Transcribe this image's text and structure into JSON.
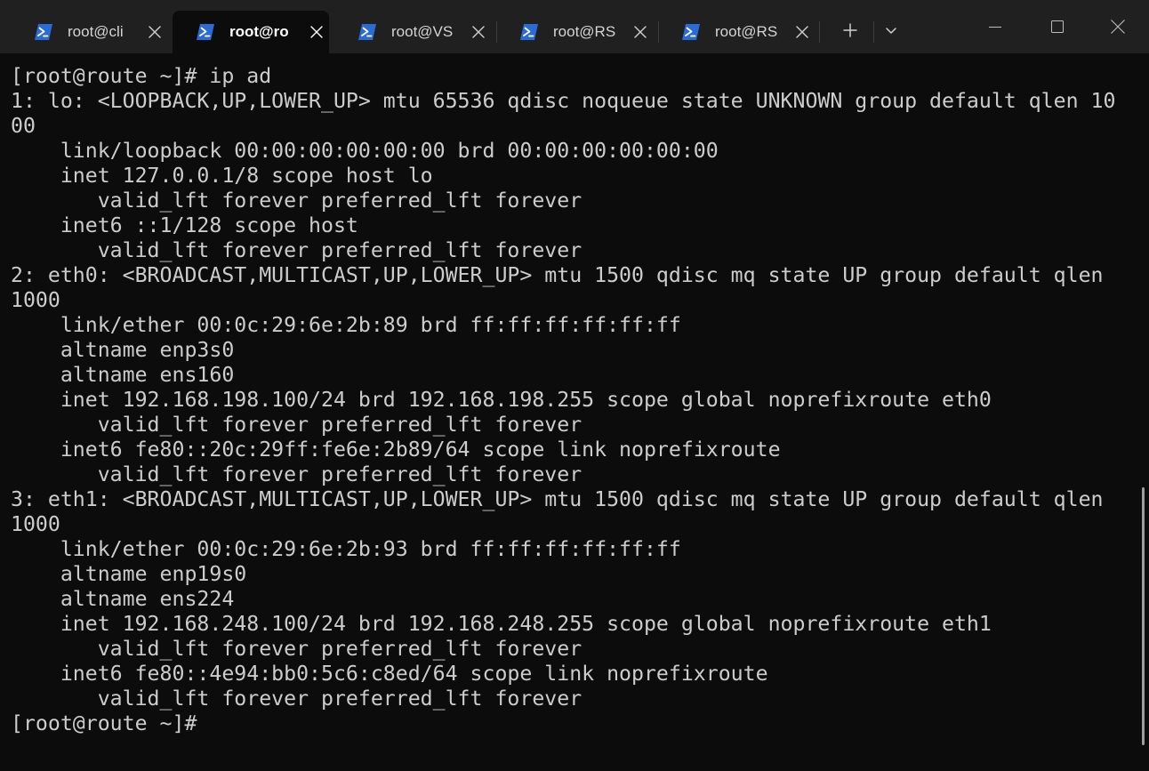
{
  "tabs": [
    {
      "title": "root@cli",
      "active": false
    },
    {
      "title": "root@ro",
      "active": true
    },
    {
      "title": "root@VS",
      "active": false
    },
    {
      "title": "root@RS",
      "active": false
    },
    {
      "title": "root@RS",
      "active": false
    }
  ],
  "icons": {
    "tab_icon": "powershell-icon",
    "tab_close": "close-icon",
    "new_tab": "plus-icon",
    "dropdown": "chevron-down-icon",
    "minimize": "minimize-icon",
    "maximize": "maximize-icon",
    "close_window": "close-icon"
  },
  "colors": {
    "background": "#0c0c0c",
    "titlebar": "#202020",
    "foreground": "#cccccc",
    "tab_icon_bg": "#2b6bd6"
  },
  "terminal": {
    "lines": [
      "[root@route ~]# ip ad",
      "1: lo: <LOOPBACK,UP,LOWER_UP> mtu 65536 qdisc noqueue state UNKNOWN group default qlen 10",
      "00",
      "    link/loopback 00:00:00:00:00:00 brd 00:00:00:00:00:00",
      "    inet 127.0.0.1/8 scope host lo",
      "       valid_lft forever preferred_lft forever",
      "    inet6 ::1/128 scope host",
      "       valid_lft forever preferred_lft forever",
      "2: eth0: <BROADCAST,MULTICAST,UP,LOWER_UP> mtu 1500 qdisc mq state UP group default qlen",
      "1000",
      "    link/ether 00:0c:29:6e:2b:89 brd ff:ff:ff:ff:ff:ff",
      "    altname enp3s0",
      "    altname ens160",
      "    inet 192.168.198.100/24 brd 192.168.198.255 scope global noprefixroute eth0",
      "       valid_lft forever preferred_lft forever",
      "    inet6 fe80::20c:29ff:fe6e:2b89/64 scope link noprefixroute",
      "       valid_lft forever preferred_lft forever",
      "3: eth1: <BROADCAST,MULTICAST,UP,LOWER_UP> mtu 1500 qdisc mq state UP group default qlen",
      "1000",
      "    link/ether 00:0c:29:6e:2b:93 brd ff:ff:ff:ff:ff:ff",
      "    altname enp19s0",
      "    altname ens224",
      "    inet 192.168.248.100/24 brd 192.168.248.255 scope global noprefixroute eth1",
      "       valid_lft forever preferred_lft forever",
      "    inet6 fe80::4e94:bb0:5c6:c8ed/64 scope link noprefixroute",
      "       valid_lft forever preferred_lft forever",
      "[root@route ~]#"
    ]
  }
}
